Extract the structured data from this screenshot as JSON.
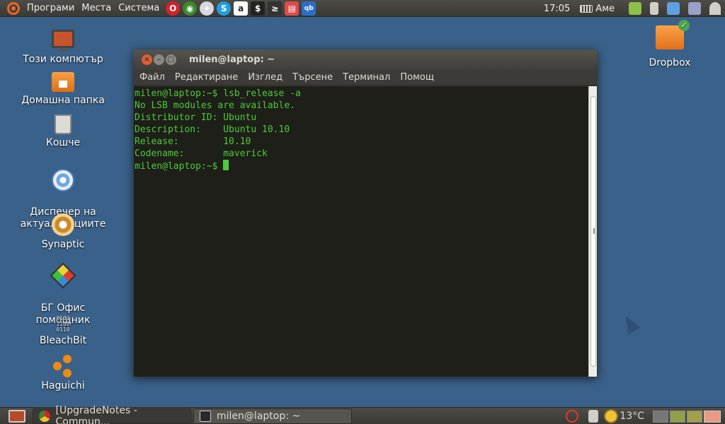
{
  "top_panel": {
    "menus": [
      "Програми",
      "Места",
      "Система"
    ],
    "launchers": [
      {
        "icon": "opera-icon",
        "color": "#d8202a",
        "glyph": "O"
      },
      {
        "icon": "chrome-icon",
        "color": "#3a8a2a",
        "glyph": "◉"
      },
      {
        "icon": "pidgin-icon",
        "color": "#d8d8e0",
        "glyph": "✦"
      },
      {
        "icon": "skype-icon",
        "color": "#1ea0e0",
        "glyph": "S"
      },
      {
        "icon": "amarok-icon",
        "color": "#ffffff",
        "glyph": "a"
      },
      {
        "icon": "terminal-icon",
        "color": "#222222",
        "glyph": "$"
      },
      {
        "icon": "remote-desktop-icon",
        "color": "#333333",
        "glyph": "≥"
      },
      {
        "icon": "archive-icon",
        "color": "#e04a4a",
        "glyph": "▤"
      },
      {
        "icon": "qbittorrent-icon",
        "color": "#2e6ec8",
        "glyph": "qb"
      }
    ],
    "clock": "17:05",
    "keyboard_layout": "Аме",
    "tray_icons": [
      {
        "name": "battery-icon",
        "color": "#8cc04a"
      },
      {
        "name": "volume-icon",
        "color": "#cfcfc8"
      },
      {
        "name": "dropbox-tray-icon",
        "color": "#5fa0e0"
      },
      {
        "name": "k-icon",
        "color": "#9aa0c8"
      },
      {
        "name": "wifi-icon",
        "color": "#cfcfc8"
      }
    ]
  },
  "desktop_icons": [
    {
      "label": "Този компютър",
      "icon": "computer-icon"
    },
    {
      "label": "Домашна папка",
      "icon": "home-folder-icon"
    },
    {
      "label": "Кошче",
      "icon": "trash-icon"
    },
    {
      "label": "Диспечер на\nактуализациите",
      "icon": "update-manager-icon"
    },
    {
      "label": "Synaptic",
      "icon": "synaptic-icon"
    },
    {
      "label": "БГ Офис\nпомощник",
      "icon": "bg-office-icon"
    },
    {
      "label": "BleachBit",
      "icon": "bleachbit-icon"
    },
    {
      "label": "Haguichi",
      "icon": "haguichi-icon"
    }
  ],
  "dropbox_icon": {
    "label": "Dropbox",
    "icon": "dropbox-folder-icon"
  },
  "terminal": {
    "title": "milen@laptop: ~",
    "menu": [
      "Файл",
      "Редактиране",
      "Изглед",
      "Търсене",
      "Терминал",
      "Помощ"
    ],
    "lines": [
      "milen@laptop:~$ lsb_release -a",
      "No LSB modules are available.",
      "Distributor ID: Ubuntu",
      "Description:    Ubuntu 10.10",
      "Release:        10.10",
      "Codename:       maverick"
    ],
    "prompt": "milen@laptop:~$ ",
    "text_color": "#4ec93d",
    "background_color": "#1e1f18"
  },
  "bottom_panel": {
    "tasks": [
      {
        "label": "[UpgradeNotes - Commun...",
        "icon": "chrome-icon",
        "active": false
      },
      {
        "label": "milen@laptop: ~",
        "icon": "terminal-icon",
        "active": true
      }
    ],
    "temperature": "13°C",
    "workspaces": 4
  }
}
